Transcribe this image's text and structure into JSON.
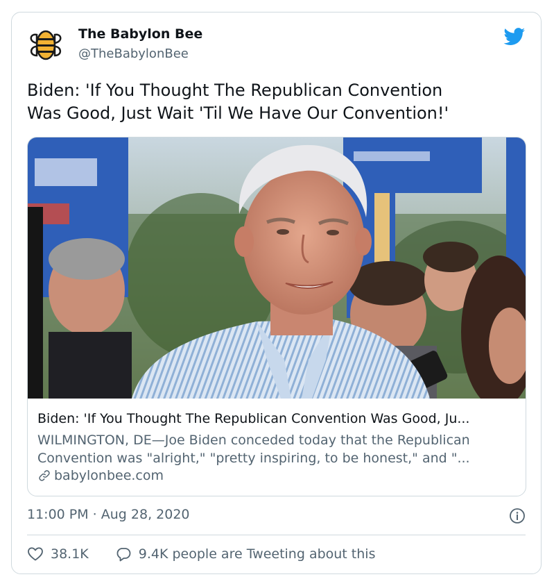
{
  "author": {
    "name": "The Babylon Bee",
    "handle": "@TheBabylonBee"
  },
  "tweet": {
    "text_line1": "Biden: 'If You Thought The Republican Convention",
    "text_line2": "Was Good, Just Wait 'Til We Have Our Convention!'"
  },
  "card": {
    "title": "Biden: 'If You Thought The Republican Convention Was Good, Ju...",
    "description_line1": "WILMINGTON, DE—Joe Biden conceded today that the Republican",
    "description_line2": "Convention was \"alright,\" \"pretty inspiring, to be honest,\" and \"...",
    "domain": "babylonbee.com"
  },
  "meta": {
    "timestamp": "11:00 PM · Aug 28, 2020"
  },
  "actions": {
    "likes": "38.1K",
    "replies_text": "9.4K people are Tweeting about this"
  },
  "colors": {
    "twitter_blue": "#1d9bf0",
    "text_secondary": "#536471",
    "border": "#cfd9de",
    "bee_yellow": "#f2b233"
  },
  "icons": [
    "babylon-bee-logo",
    "twitter-bird-icon",
    "link-icon",
    "info-icon",
    "heart-icon",
    "reply-icon"
  ]
}
